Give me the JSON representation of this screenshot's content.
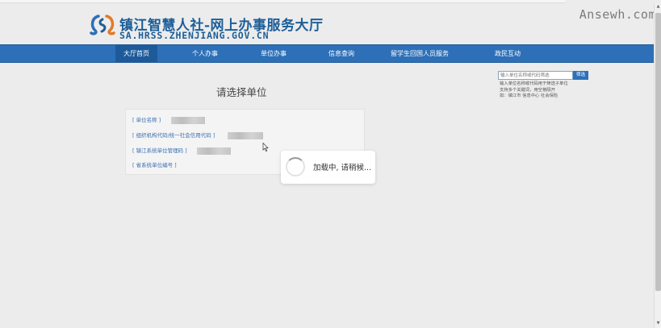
{
  "watermark": "Ansewh.com",
  "header": {
    "title": "镇江智慧人社-网上办事服务大厅",
    "url": "SA.HRSS.ZHENJIANG.GOV.CN"
  },
  "nav": {
    "items": [
      {
        "label": "大厅首页"
      },
      {
        "label": "个人办事"
      },
      {
        "label": "单位办事"
      },
      {
        "label": "信息查询"
      },
      {
        "label": "留学生回国人员服务"
      },
      {
        "label": "政民互动"
      }
    ]
  },
  "search": {
    "placeholder": "输入单位名称或代码筛选",
    "button_label": "筛选",
    "help_lines": [
      "输入单位名称或代码用于筛选子单位",
      "支持多个关键词，用空格隔开",
      "如：镇江市 信息中心 社会保险"
    ]
  },
  "main": {
    "title": "请选择单位",
    "fields": [
      {
        "label": "[ 单位名称 ]"
      },
      {
        "label": "[ 组织机构代码/统一社会信用代码 ]"
      },
      {
        "label": "[ 镇江系统单位管理码 ]"
      },
      {
        "label": "[ 省系统单位编号 ]"
      }
    ]
  },
  "loading": {
    "text": "加载中, 请稍候..."
  },
  "colors": {
    "nav_bg": "#2d70b8",
    "nav_active": "#1d5a9a",
    "title_blue": "#1d5e98",
    "link_blue": "#3a6fb0",
    "page_bg": "#ececec"
  },
  "icons": {
    "logo": "zhenjiang-hrss-logo",
    "spinner": "loading-spinner-icon",
    "cursor": "mouse-pointer-icon"
  }
}
